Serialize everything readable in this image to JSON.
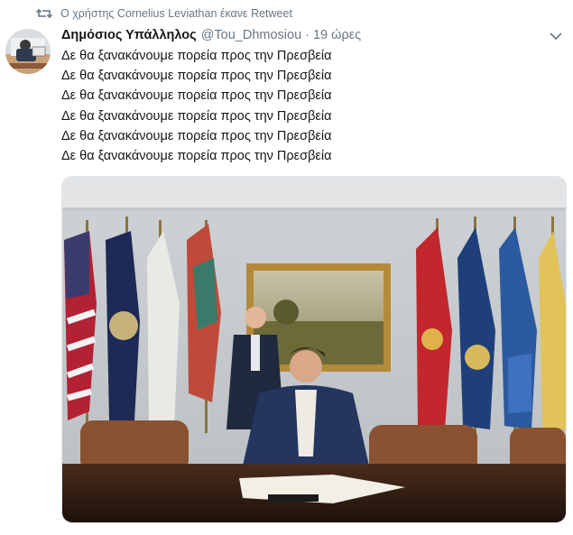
{
  "retweet": {
    "icon": "retweet-icon",
    "text": "Ο χρήστης Cornelius Leviathan έκανε Retweet"
  },
  "tweet": {
    "display_name": "Δημόσιος Υπάλληλος",
    "handle": "@Tou_Dhmosiou",
    "separator": "·",
    "time": "19 ώρες",
    "lines": [
      "Δε θα ξανακάνουμε πορεία προς την Πρεσβεία",
      "Δε θα ξανακάνουμε πορεία προς την Πρεσβεία",
      "Δε θα ξανακάνουμε πορεία προς την Πρεσβεία",
      "Δε θα ξανακάνουμε πορεία προς την Πρεσβεία",
      "Δε θα ξανακάνουμε πορεία προς την Πρεσβεία",
      "Δε θα ξανακάνουμε πορεία προς την Πρεσβεία"
    ],
    "menu_icon": "chevron-down-icon"
  },
  "colors": {
    "text": "#14171a",
    "muted": "#657786",
    "border": "#e1e8ed"
  }
}
